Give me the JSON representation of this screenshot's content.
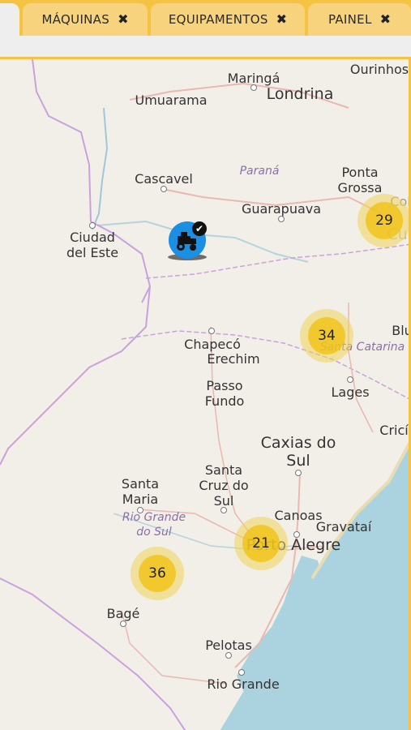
{
  "tabs": [
    {
      "label": "MÁQUINAS",
      "close": "✖"
    },
    {
      "label": "EQUIPAMENTOS",
      "close": "✖"
    },
    {
      "label": "PAINEL",
      "close": "✖"
    }
  ],
  "map": {
    "cities": {
      "ourinhos": "Ourinhos",
      "maringa": "Maringá",
      "londrina": "Londrina",
      "umuarama": "Umuarama",
      "cascavel": "Cascavel",
      "ponta_grossa": "Ponta\nGrossa",
      "guarapuava": "Guarapuava",
      "ciudad_del_este": "Ciudad\ndel Este",
      "chapeco": "Chapecó",
      "erechim": "Erechim",
      "passo_fundo": "Passo\nFundo",
      "lages": "Lages",
      "caxias_do_sul": "Caxias do\nSul",
      "santa_maria": "Santa\nMaria",
      "santa_cruz_do_sul": "Santa\nCruz do\nSul",
      "canoas": "Canoas",
      "gravatai": "Gravataí",
      "porto_alegre": "Porto Alegre",
      "bage": "Bagé",
      "pelotas": "Pelotas",
      "rio_grande": "Rio Grande",
      "edge_col": "Col",
      "edge_cur": "Cur",
      "edge_blu": "Blu",
      "edge_cric": "Cricí"
    },
    "states": {
      "parana": "Paraná",
      "santa_catarina": "Santa Catarina",
      "rio_grande_do_sul": "Rio Grande\ndo Sul"
    },
    "clusters": {
      "ponta_grossa_cluster": "29",
      "santa_catarina_cluster": "34",
      "porto_alegre_cluster": "21",
      "santa_maria_cluster": "36"
    },
    "marker_icon": "tractor-icon",
    "marker_status_icon": "check-icon"
  },
  "colors": {
    "tabbar": "#f5c343",
    "tab": "#f7d37e",
    "land": "#f2efe9",
    "water": "#aad3df",
    "border": "#c9a2dd",
    "road": "#e9b8b0",
    "cluster": "#f0c20c",
    "marker": "#1a8fe3"
  }
}
